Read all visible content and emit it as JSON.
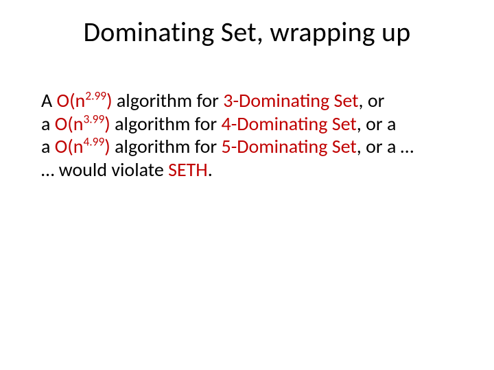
{
  "title": "Dominating Set, wrapping up",
  "lines": {
    "l1": {
      "pre": "A ",
      "alg_o": "O(n",
      "exp": "2.99",
      "alg_c": ")",
      "mid": " algorithm for ",
      "ds": "3-Dominating Set",
      "post": ", or"
    },
    "l2": {
      "pre": "a ",
      "alg_o": "O(n",
      "exp": "3.99",
      "alg_c": ")",
      "mid": " algorithm for ",
      "ds": "4-Dominating Set",
      "post": ", or a"
    },
    "l3": {
      "pre": "a ",
      "alg_o": "O(n",
      "exp": "4.99",
      "alg_c": ")",
      "mid": " algorithm for ",
      "ds": "5-Dominating Set",
      "post": ", or a …"
    },
    "l4": {
      "pre": "… would violate ",
      "seth": "SETH",
      "post": "."
    }
  }
}
